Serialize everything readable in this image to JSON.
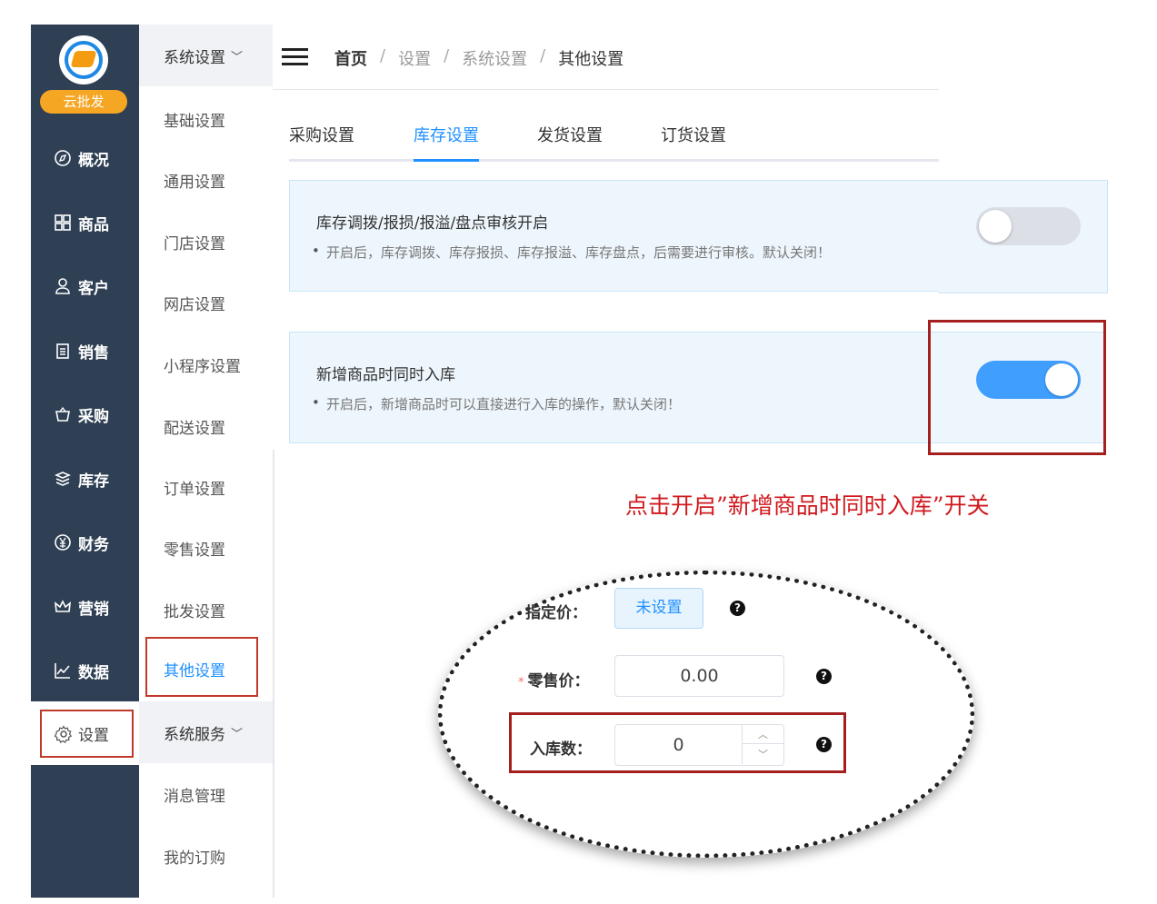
{
  "brand": {
    "badge": "云批发"
  },
  "nav": {
    "items": [
      {
        "label": "概况",
        "icon": "compass-icon"
      },
      {
        "label": "商品",
        "icon": "grid-icon"
      },
      {
        "label": "客户",
        "icon": "user-icon"
      },
      {
        "label": "销售",
        "icon": "clipboard-icon"
      },
      {
        "label": "采购",
        "icon": "basket-icon"
      },
      {
        "label": "库存",
        "icon": "layers-icon"
      },
      {
        "label": "财务",
        "icon": "yen-icon"
      },
      {
        "label": "营销",
        "icon": "crown-icon"
      },
      {
        "label": "数据",
        "icon": "chart-line-icon"
      }
    ],
    "settings": "设置"
  },
  "submenu": {
    "group1": "系统设置",
    "items": [
      "基础设置",
      "通用设置",
      "门店设置",
      "网店设置",
      "小程序设置",
      "配送设置",
      "订单设置",
      "零售设置",
      "批发设置"
    ],
    "active": "其他设置",
    "group2": "系统服务",
    "items2": [
      "消息管理",
      "我的订购"
    ]
  },
  "breadcrumb": [
    "首页",
    "设置",
    "系统设置",
    "其他设置"
  ],
  "tabs": [
    "采购设置",
    "库存设置",
    "发货设置",
    "订货设置"
  ],
  "active_tab": "库存设置",
  "cards": [
    {
      "title": "库存调拨/报损/报溢/盘点审核开启",
      "desc": "开启后，库存调拨、库存报损、库存报溢、库存盘点，后需要进行审核。默认关闭！",
      "enabled": false
    },
    {
      "title": "新增商品时同时入库",
      "desc": "开启后，新增商品时可以直接进行入库的操作，默认关闭！",
      "enabled": true
    }
  ],
  "annotation": "点击开启”新增商品时同时入库”开关",
  "form": {
    "price_label": "指定价：",
    "price_button": "未设置",
    "retail_label": "零售价：",
    "retail_value": "0.00",
    "qty_label": "入库数：",
    "qty_value": "0",
    "help": "?",
    "required_mark": "*"
  },
  "colors": {
    "accent": "#1e90ff",
    "sidebar": "#2f4055",
    "highlight": "#a51f1f",
    "annotation": "#d0191e"
  }
}
